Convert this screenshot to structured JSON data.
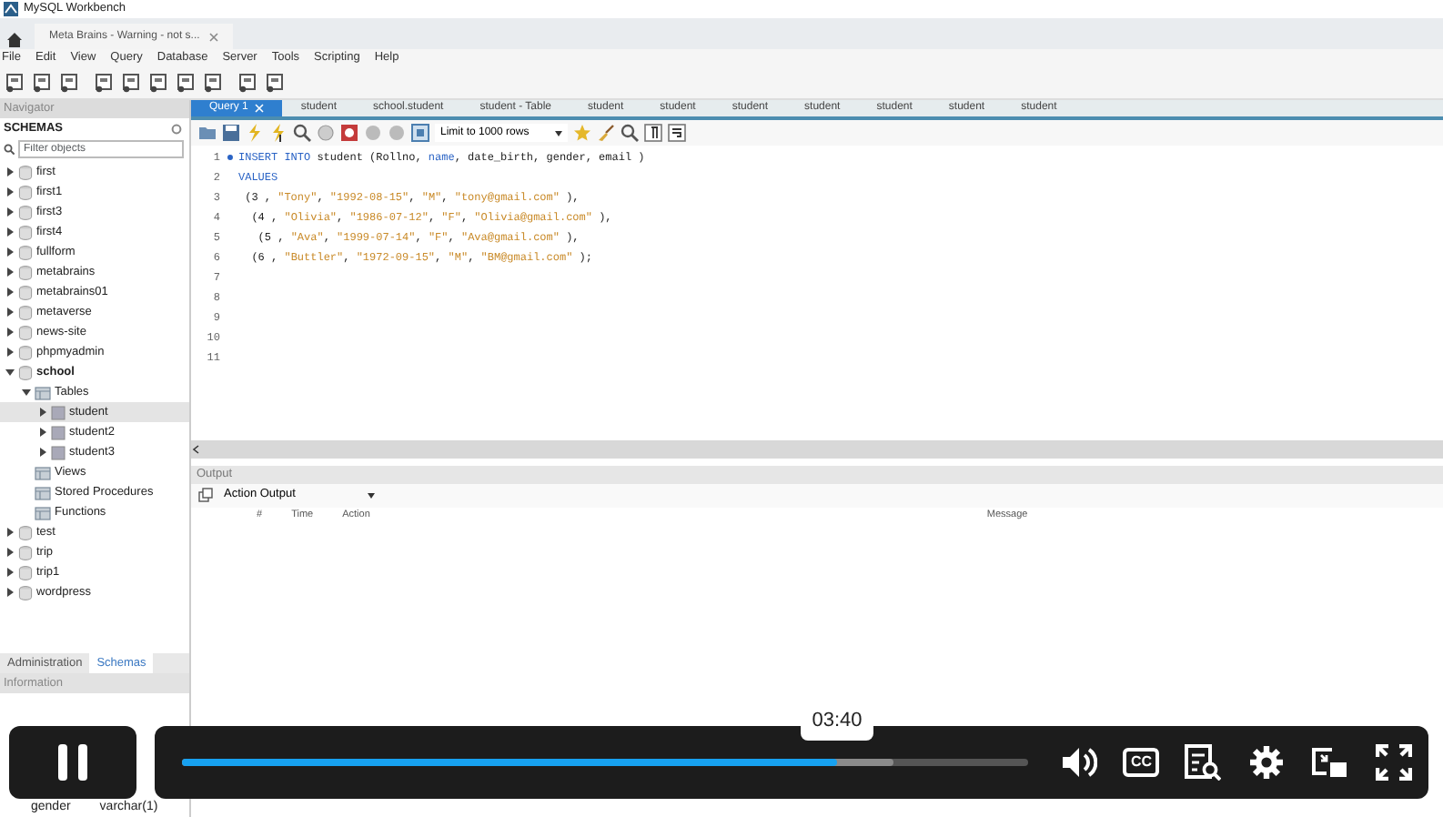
{
  "window": {
    "title": "MySQL Workbench"
  },
  "document_tabs": [
    {
      "label": "Meta Brains - Warning - not s...",
      "selected": true
    }
  ],
  "menu": [
    "File",
    "Edit",
    "View",
    "Query",
    "Database",
    "Server",
    "Tools",
    "Scripting",
    "Help"
  ],
  "navigator": {
    "title": "Navigator",
    "schemas_heading": "SCHEMAS",
    "filter": {
      "placeholder": "Filter objects"
    },
    "tree": [
      {
        "label": "first",
        "kind": "schema",
        "expanded": false,
        "default": false,
        "selected": false
      },
      {
        "label": "first1",
        "kind": "schema",
        "expanded": false,
        "default": false,
        "selected": false
      },
      {
        "label": "first3",
        "kind": "schema",
        "expanded": false,
        "default": false,
        "selected": false
      },
      {
        "label": "first4",
        "kind": "schema",
        "expanded": false,
        "default": false,
        "selected": false
      },
      {
        "label": "fullform",
        "kind": "schema",
        "expanded": false,
        "default": false,
        "selected": false
      },
      {
        "label": "metabrains",
        "kind": "schema",
        "expanded": false,
        "default": false,
        "selected": false
      },
      {
        "label": "metabrains01",
        "kind": "schema",
        "expanded": false,
        "default": false,
        "selected": false
      },
      {
        "label": "metaverse",
        "kind": "schema",
        "expanded": false,
        "default": false,
        "selected": false
      },
      {
        "label": "news-site",
        "kind": "schema",
        "expanded": false,
        "default": false,
        "selected": false
      },
      {
        "label": "phpmyadmin",
        "kind": "schema",
        "expanded": false,
        "default": false,
        "selected": false
      },
      {
        "label": "school",
        "kind": "schema",
        "expanded": true,
        "default": true,
        "selected": false,
        "children": [
          {
            "label": "Tables",
            "kind": "folder",
            "expanded": true,
            "selected": false,
            "children": [
              {
                "label": "student",
                "kind": "table",
                "expanded": false,
                "selected": true
              },
              {
                "label": "student2",
                "kind": "table",
                "expanded": false,
                "selected": false
              },
              {
                "label": "student3",
                "kind": "table",
                "expanded": false,
                "selected": false
              }
            ]
          },
          {
            "label": "Views",
            "kind": "folder",
            "selected": false
          },
          {
            "label": "Stored Procedures",
            "kind": "folder",
            "selected": false
          },
          {
            "label": "Functions",
            "kind": "folder",
            "selected": false
          }
        ]
      },
      {
        "label": "test",
        "kind": "schema",
        "expanded": false,
        "default": false,
        "selected": false
      },
      {
        "label": "trip",
        "kind": "schema",
        "expanded": false,
        "default": false,
        "selected": false
      },
      {
        "label": "trip1",
        "kind": "schema",
        "expanded": false,
        "default": false,
        "selected": false
      },
      {
        "label": "wordpress",
        "kind": "schema",
        "expanded": false,
        "default": false,
        "selected": false
      }
    ],
    "bottom_tabs": [
      {
        "label": "Administration",
        "selected": false
      },
      {
        "label": "Schemas",
        "selected": true
      }
    ],
    "information": {
      "title": "Information",
      "columns": [
        {
          "name": "gender",
          "type": "varchar(1)"
        }
      ]
    }
  },
  "query_tabs": [
    {
      "label": "Query 1",
      "selected": true
    },
    {
      "label": "student",
      "selected": false
    },
    {
      "label": "school.student",
      "selected": false
    },
    {
      "label": "student - Table",
      "selected": false
    },
    {
      "label": "student",
      "selected": false
    },
    {
      "label": "student",
      "selected": false
    },
    {
      "label": "student",
      "selected": false
    },
    {
      "label": "student",
      "selected": false
    },
    {
      "label": "student",
      "selected": false
    },
    {
      "label": "student",
      "selected": false
    },
    {
      "label": "student",
      "selected": false
    }
  ],
  "editor_toolbar": {
    "limit": "Limit to 1000 rows"
  },
  "editor": {
    "lines": [
      {
        "number": "1",
        "marker": true,
        "segments": [
          {
            "kind": "keyword",
            "text": "INSERT INTO"
          },
          {
            "kind": "plain",
            "text": " student (Rollno, "
          },
          {
            "kind": "keyword",
            "text": "name"
          },
          {
            "kind": "plain",
            "text": ", date_birth, gender, email )"
          }
        ]
      },
      {
        "number": "2",
        "marker": false,
        "segments": [
          {
            "kind": "keyword",
            "text": "VALUES"
          }
        ]
      },
      {
        "number": "3",
        "marker": false,
        "segments": [
          {
            "kind": "plain",
            "text": " (3 , \"Tony\", \"1992-08-15\", \"M\", \"tony@gmail.com\" ),"
          }
        ]
      },
      {
        "number": "4",
        "marker": false,
        "segments": [
          {
            "kind": "plain",
            "text": "  (4 , \"Olivia\", \"1986-07-12\", \"F\", \"Olivia@gmail.com\" ),"
          }
        ]
      },
      {
        "number": "5",
        "marker": false,
        "segments": [
          {
            "kind": "plain",
            "text": "   (5 , \"Ava\", \"1999-07-14\", \"F\", \"Ava@gmail.com\" ),"
          }
        ]
      },
      {
        "number": "6",
        "marker": false,
        "segments": [
          {
            "kind": "plain",
            "text": "  (6 , \"Buttler\", \"1972-09-15\", \"M\", \"BM@gmail.com\" );"
          }
        ]
      },
      {
        "number": "7",
        "marker": false
      },
      {
        "number": "8",
        "marker": false
      },
      {
        "number": "9",
        "marker": false
      },
      {
        "number": "10",
        "marker": false
      },
      {
        "number": "11",
        "marker": false
      }
    ]
  },
  "output": {
    "title": "Output",
    "selector": "Action Output",
    "columns": [
      "#",
      "Time",
      "Action",
      "Message"
    ]
  },
  "player": {
    "playing": true,
    "time_tooltip": "03:40",
    "progress": {
      "level": 0.774
    },
    "buffer": {
      "level": 0.84
    },
    "captions_label": "CC"
  }
}
